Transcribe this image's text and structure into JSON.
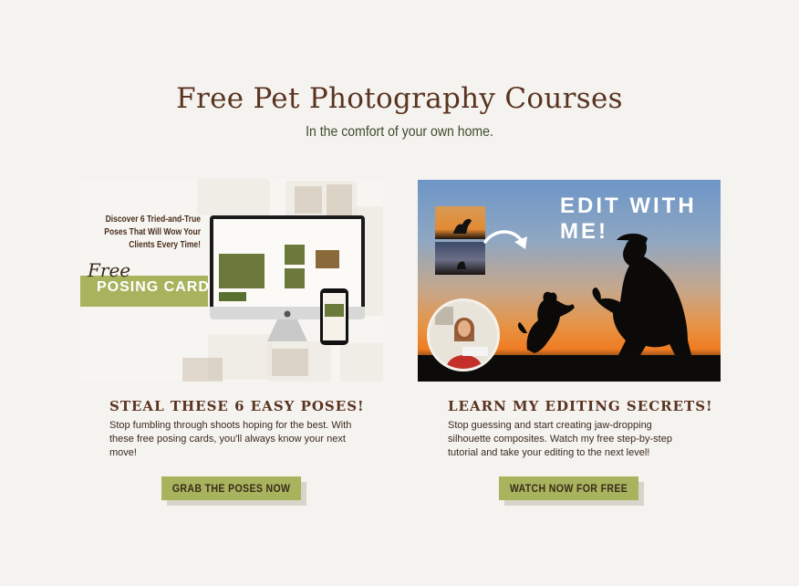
{
  "hero": {
    "title": "Free Pet Photography Courses",
    "subtitle": "In the comfort of your own home."
  },
  "left_course": {
    "promo": {
      "tagline": "Discover 6 Tried-and-True Poses That Will Wow Your Clients Every Time!",
      "script_word": "Free",
      "banner_label": "POSING CARDS"
    },
    "heading": "STEAL THESE 6 EASY POSES!",
    "description": "Stop fumbling through shoots hoping for the best. With these free posing cards, you'll always know your next move!",
    "cta_label": "GRAB THE POSES NOW"
  },
  "right_course": {
    "promo": {
      "overlay_label": "EDIT WITH ME!"
    },
    "heading": "LEARN MY EDITING SECRETS!",
    "description": "Stop guessing and start creating jaw-dropping silhouette composites. Watch my free step-by-step tutorial and take your editing to the next level!",
    "cta_label": "WATCH NOW FOR FREE"
  },
  "colors": {
    "background": "#f5f3f0",
    "heading_brown": "#5a3420",
    "accent_green": "#a8b35e",
    "button_shadow": "#d8d4c9"
  },
  "icons": [
    "curved-arrow-icon",
    "apple-logo-icon"
  ]
}
